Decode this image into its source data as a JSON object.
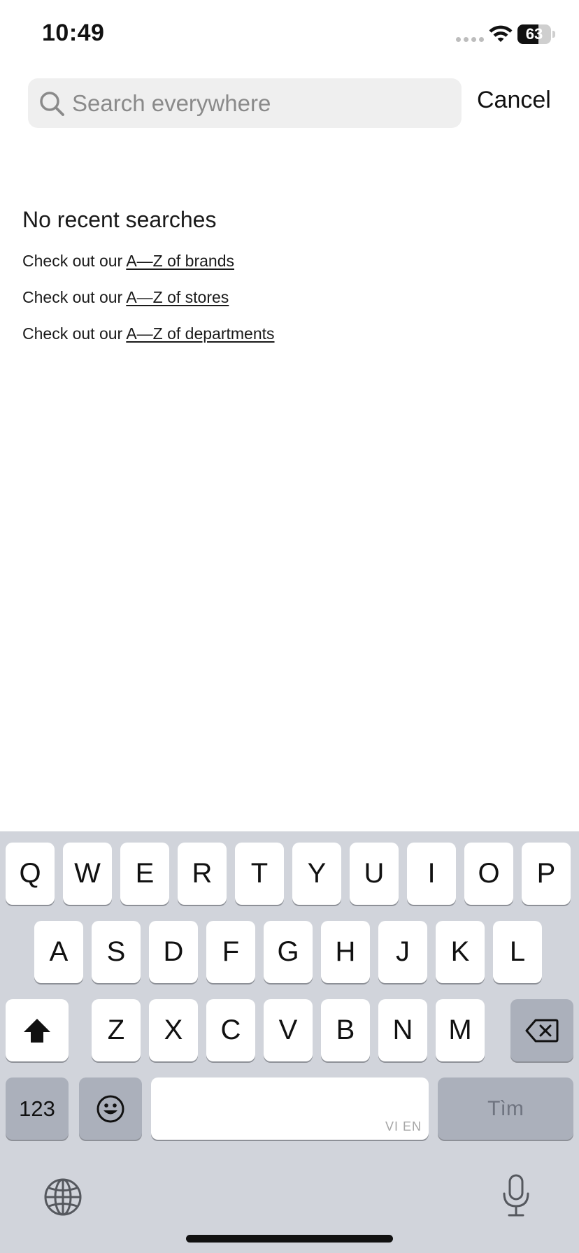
{
  "status_bar": {
    "time": "10:49",
    "battery_percent": 63,
    "battery_label": "63"
  },
  "search": {
    "placeholder": "Search everywhere",
    "value": "",
    "cancel_label": "Cancel"
  },
  "recent": {
    "heading": "No recent searches",
    "links": [
      {
        "prefix": "Check out our ",
        "link": "A—Z of brands"
      },
      {
        "prefix": "Check out our ",
        "link": "A—Z of stores"
      },
      {
        "prefix": "Check out our ",
        "link": "A—Z of departments"
      }
    ]
  },
  "keyboard": {
    "row1": [
      "Q",
      "W",
      "E",
      "R",
      "T",
      "Y",
      "U",
      "I",
      "O",
      "P"
    ],
    "row2": [
      "A",
      "S",
      "D",
      "F",
      "G",
      "H",
      "J",
      "K",
      "L"
    ],
    "row3": [
      "Z",
      "X",
      "C",
      "V",
      "B",
      "N",
      "M"
    ],
    "numbers_label": "123",
    "space_language": "VI EN",
    "return_label": "Tìm"
  },
  "colors": {
    "background": "#ffffff",
    "search_field": "#efefef",
    "keyboard": "#d1d4db",
    "key": "#ffffff",
    "dark_key": "#abb0bb"
  }
}
